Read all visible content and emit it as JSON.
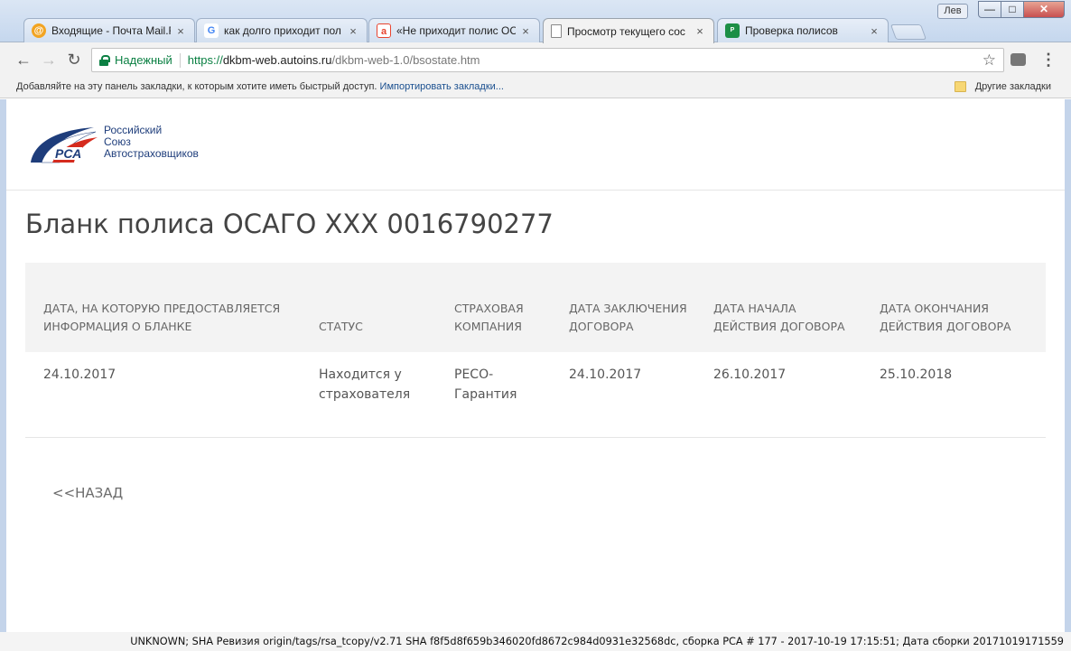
{
  "window": {
    "user_badge": "Лев",
    "min_glyph": "—",
    "max_glyph": "□",
    "close_glyph": "✕"
  },
  "tabs": [
    {
      "title": "Входящие - Почта Mail.R",
      "icon": "mail-ru-icon",
      "active": false
    },
    {
      "title": "как долго приходит пол",
      "icon": "google-icon",
      "active": false
    },
    {
      "title": "«Не приходит полис ОС",
      "icon": "otvety-icon",
      "active": false
    },
    {
      "title": "Просмотр текущего сос",
      "icon": "page-icon",
      "active": true
    },
    {
      "title": "Проверка полисов",
      "icon": "reso-icon",
      "active": false
    }
  ],
  "tab_close_glyph": "×",
  "toolbar": {
    "back_glyph": "←",
    "forward_glyph": "→",
    "reload_glyph": "↻",
    "secure_label": "Надежный",
    "url_protocol": "https://",
    "url_host": "dkbm-web.autoins.ru",
    "url_path": "/dkbm-web-1.0/bsostate.htm",
    "star_glyph": "☆",
    "menu_glyph": "⋮"
  },
  "bookmarks": {
    "prompt": "Добавляйте на эту панель закладки, к которым хотите иметь быстрый доступ. ",
    "import_link": "Импортировать закладки...",
    "other": "Другие закладки"
  },
  "logo": {
    "abbr": "РСА",
    "line1": "Российский",
    "line2": "Союз",
    "line3": "Автостраховщиков"
  },
  "page_title": "Бланк полиса ОСАГО ХХХ 0016790277",
  "table": {
    "headers": [
      "Дата, на которую предоставляется информация о бланке",
      "Статус",
      "Страховая компания",
      "Дата заключения договора",
      "Дата начала действия договора",
      "Дата окончания действия договора"
    ],
    "row": [
      "24.10.2017",
      "Находится у страхователя",
      "РЕСО-Гарантия",
      "24.10.2017",
      "26.10.2017",
      "25.10.2018"
    ]
  },
  "back_link": "<<НАЗАД",
  "build_info": "UNKNOWN; SHA Ревизия origin/tags/rsa_tcopy/v2.71 SHA f8f5d8f659b346020fd8672c984d0931e32568dc, сборка РСА # 177 - 2017-10-19 17:15:51; Дата сборки 20171019171559",
  "colors": {
    "secure_green": "#0b8043",
    "rsa_blue": "#1e3d7b",
    "rsa_red": "#d52b1e",
    "table_header_bg": "#f3f3f3"
  }
}
